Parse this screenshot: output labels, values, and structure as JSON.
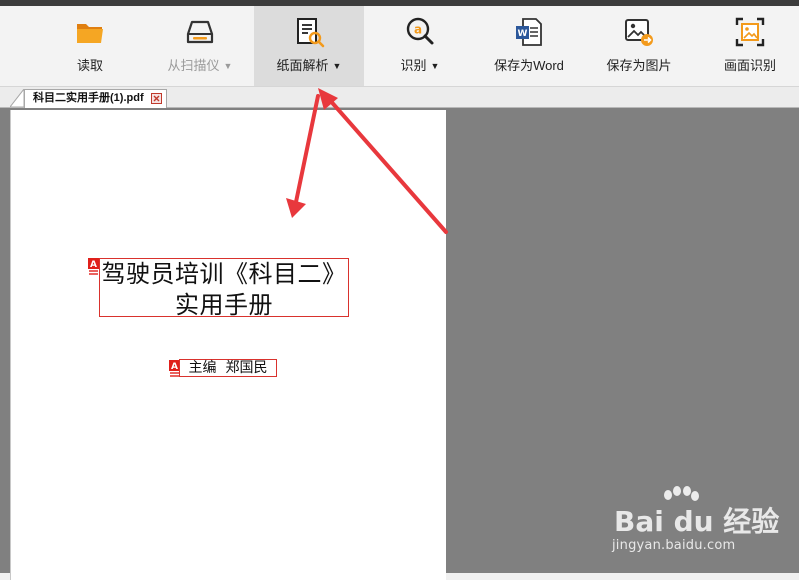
{
  "toolbar": {
    "items": [
      {
        "id": "read",
        "label": "读取",
        "icon": "folder-icon",
        "enabled": true,
        "active": false,
        "dropdown": false
      },
      {
        "id": "scanner",
        "label": "从扫描仪",
        "icon": "scanner-icon",
        "enabled": false,
        "active": false,
        "dropdown": true
      },
      {
        "id": "paper-analysis",
        "label": "纸面解析",
        "icon": "document-search-icon",
        "enabled": true,
        "active": true,
        "dropdown": true
      },
      {
        "id": "recognize",
        "label": "识别",
        "icon": "recognize-icon",
        "enabled": true,
        "active": false,
        "dropdown": true
      },
      {
        "id": "save-word",
        "label": "保存为Word",
        "icon": "word-icon",
        "enabled": true,
        "active": false,
        "dropdown": false
      },
      {
        "id": "save-image",
        "label": "保存为图片",
        "icon": "save-image-icon",
        "enabled": true,
        "active": false,
        "dropdown": false
      },
      {
        "id": "screen-ocr",
        "label": "画面识别",
        "icon": "screen-capture-icon",
        "enabled": true,
        "active": false,
        "dropdown": false
      }
    ],
    "caret": "▼"
  },
  "tabs": [
    {
      "label": "科目二实用手册(1).pdf",
      "close_icon": "close-icon"
    }
  ],
  "document": {
    "title_line1": "驾驶员培训《科目二》",
    "title_line2": "实用手册",
    "author": "主编  郑国民"
  },
  "watermark": {
    "logo": "Bai du 经验",
    "site": "jingyan.baidu.com"
  },
  "colors": {
    "accent_orange": "#f39a1b",
    "annotation_red": "#d9322d",
    "arrow_red": "#e8383d",
    "word_blue": "#2b579a",
    "viewer_gray": "#808080"
  }
}
